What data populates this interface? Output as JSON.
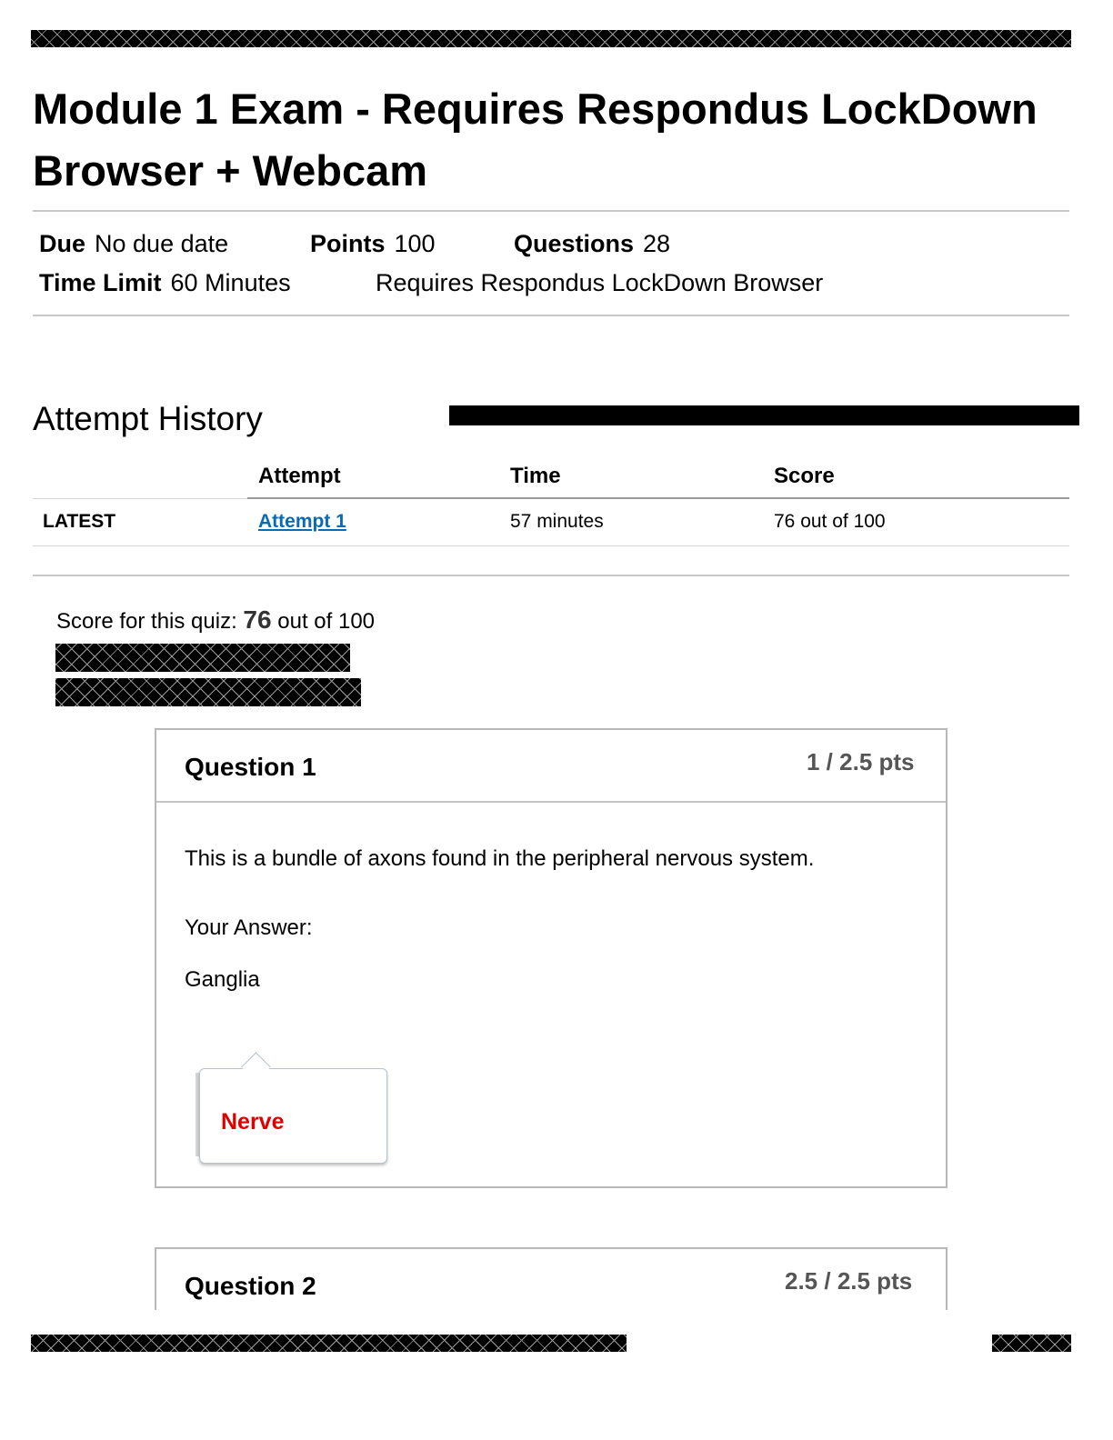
{
  "header": {
    "title": "Module 1 Exam - Requires Respondus LockDown Browser + Webcam"
  },
  "details": {
    "due_label": "Due",
    "due_value": "No due date",
    "points_label": "Points",
    "points_value": "100",
    "questions_label": "Questions",
    "questions_value": "28",
    "time_limit_label": "Time Limit",
    "time_limit_value": "60 Minutes",
    "requirement": "Requires Respondus LockDown Browser"
  },
  "attempt_history": {
    "title": "Attempt History",
    "columns": [
      "Attempt",
      "Time",
      "Score"
    ],
    "rows": [
      {
        "tag": "LATEST",
        "attempt": "Attempt 1",
        "time": "57 minutes",
        "score": "76 out of 100"
      }
    ]
  },
  "quiz_score": {
    "prefix": "Score for this quiz:",
    "score": "76",
    "suffix": "out of 100"
  },
  "questions": [
    {
      "title": "Question 1",
      "points": "1 / 2.5 pts",
      "text": "This is a bundle of axons found in the peripheral nervous system.",
      "answer_label": "Your Answer:",
      "answer": "Ganglia",
      "correct_answer": "Nerve"
    },
    {
      "title": "Question 2",
      "points": "2.5 / 2.5 pts"
    }
  ],
  "colors": {
    "link": "#0a6bb5",
    "correct_answer": "#e00000",
    "border": "#b8b8b8"
  }
}
